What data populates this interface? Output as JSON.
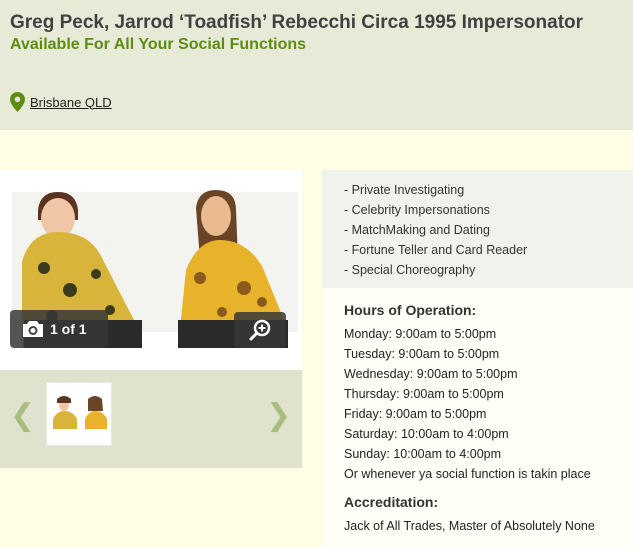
{
  "header": {
    "title": "Greg Peck, Jarrod ‘Toadfish’ Rebecchi Circa 1995 Impersonator",
    "subtitle": "Available For All Your Social Functions",
    "location": "Brisbane QLD"
  },
  "gallery": {
    "counter": "1 of 1",
    "prev_arrow": "❮",
    "next_arrow": "❯"
  },
  "services": [
    "- Private Investigating",
    "- Celebrity Impersonations",
    "- MatchMaking and Dating",
    "- Fortune Teller and Card Reader",
    "- Special Choreography"
  ],
  "hours": {
    "heading": "Hours of Operation:",
    "rows": [
      "Monday: 9:00am to 5:00pm",
      "Tuesday: 9:00am to 5:00pm",
      "Wednesday: 9:00am to 5:00pm",
      "Thursday: 9:00am to 5:00pm",
      "Friday: 9:00am to 5:00pm",
      "Saturday: 10:00am to 4:00pm",
      "Sunday: 10:00am to 4:00pm",
      "Or whenever ya social function is takin place"
    ]
  },
  "accreditation": {
    "heading": "Accreditation:",
    "text": "Jack of All Trades, Master of Absolutely None"
  },
  "colors": {
    "header_bg": "#e8ead8",
    "accent_green": "#5c8d12",
    "page_bg": "#fffde3"
  },
  "icons": {
    "location": "map-pin-icon",
    "counter": "camera-icon",
    "zoom": "zoom-in-icon"
  }
}
